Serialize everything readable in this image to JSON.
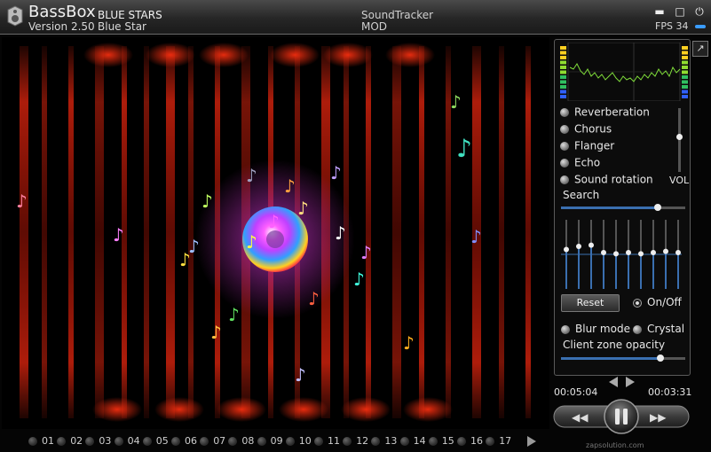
{
  "titlebar": {
    "app_name": "BassBox",
    "track_name": "BLUE STARS",
    "version": "Version 2.50",
    "skin": "Blue Star",
    "format": "SoundTracker",
    "format_sub": "MOD",
    "fps": "FPS 34",
    "minimize_glyph": "▬",
    "restore_glyph": "□",
    "power_glyph": "⏻",
    "accent_color": "#3a9cff"
  },
  "panel": {
    "detach_glyph": "↗",
    "effects": [
      {
        "label": "Reverberation",
        "on": false
      },
      {
        "label": "Chorus",
        "on": false
      },
      {
        "label": "Flanger",
        "on": false
      },
      {
        "label": "Echo",
        "on": false
      },
      {
        "label": "Sound rotation",
        "on": false
      }
    ],
    "volume_label": "VOL",
    "volume_level": 0.55,
    "search_label": "Search",
    "search_position": 0.78,
    "eq_levels": [
      0.55,
      0.6,
      0.62,
      0.5,
      0.48,
      0.5,
      0.48,
      0.5,
      0.52,
      0.5
    ],
    "reset_label": "Reset",
    "onoff_label": "On/Off",
    "blur_label": "Blur mode",
    "crystal_label": "Crystal",
    "opacity_label": "Client zone opacity",
    "opacity_position": 0.8
  },
  "transport": {
    "elapsed": "00:05:04",
    "remaining": "00:03:31",
    "rewind_glyph": "◀◀",
    "forward_glyph": "▶▶",
    "watermark": "zapsolution.com"
  },
  "patterns": [
    "01",
    "02",
    "03",
    "04",
    "05",
    "06",
    "07",
    "08",
    "09",
    "10",
    "11",
    "12",
    "13",
    "14",
    "15",
    "16",
    "17"
  ]
}
